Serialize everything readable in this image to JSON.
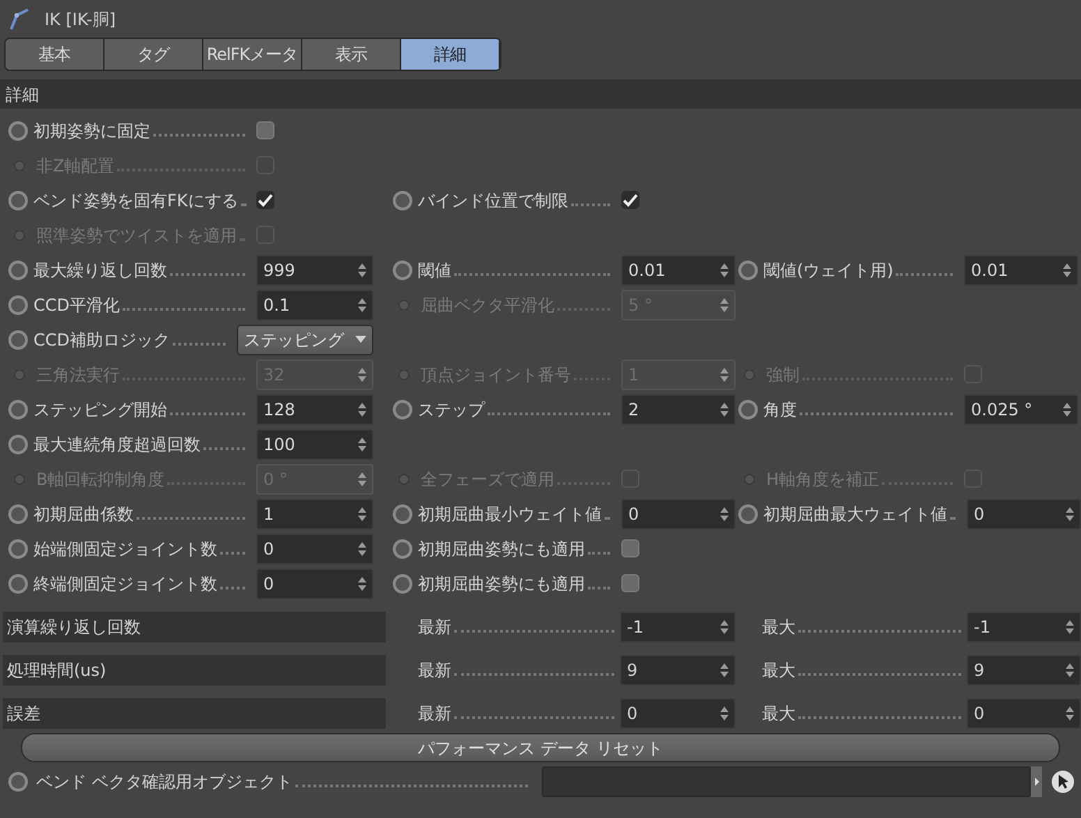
{
  "window": {
    "title": "IK [IK-胴]"
  },
  "tabs": [
    {
      "label": "基本",
      "selected": false
    },
    {
      "label": "タグ",
      "selected": false
    },
    {
      "label": "RelFKメータ",
      "selected": false
    },
    {
      "label": "表示",
      "selected": false
    },
    {
      "label": "詳細",
      "selected": true
    }
  ],
  "section": {
    "title": "詳細"
  },
  "rows": [
    {
      "col_1": {
        "kind": "checkbox",
        "label": "初期姿勢に固定",
        "checked": false,
        "disabled": false
      }
    },
    {
      "col_1": {
        "kind": "checkbox",
        "label": "非Z軸配置",
        "checked": false,
        "disabled": true
      }
    },
    {
      "col_1": {
        "kind": "checkbox",
        "label": "ベンド姿勢を固有FKにする",
        "checked": true,
        "disabled": false
      },
      "col_2": {
        "kind": "checkbox",
        "label": "バインド位置で制限",
        "checked": true,
        "disabled": false
      }
    },
    {
      "col_1": {
        "kind": "checkbox",
        "label": "照準姿勢でツイストを適用",
        "checked": false,
        "disabled": true
      }
    },
    {
      "col_1": {
        "kind": "number",
        "label": "最大繰り返し回数",
        "value": "999",
        "disabled": false
      },
      "col_2": {
        "kind": "number",
        "label": "閾値",
        "value": "0.01",
        "disabled": false
      },
      "col_3": {
        "kind": "number",
        "label": "閾値(ウェイト用)",
        "value": "0.01",
        "disabled": false
      }
    },
    {
      "col_1": {
        "kind": "number",
        "label": "CCD平滑化",
        "value": "0.1",
        "disabled": false
      },
      "col_2": {
        "kind": "number",
        "label": "屈曲ベクタ平滑化",
        "value": "5 °",
        "disabled": true
      }
    },
    {
      "col_1": {
        "kind": "dropdown",
        "label": "CCD補助ロジック",
        "value": "ステッピング",
        "disabled": false
      }
    },
    {
      "col_1": {
        "kind": "number",
        "label": "三角法実行",
        "value": "32",
        "disabled": true
      },
      "col_2": {
        "kind": "number",
        "label": "頂点ジョイント番号",
        "value": "1",
        "disabled": true
      },
      "col_3": {
        "kind": "checkbox",
        "label": "強制",
        "checked": false,
        "disabled": true
      }
    },
    {
      "col_1": {
        "kind": "number",
        "label": "ステッピング開始",
        "value": "128",
        "disabled": false
      },
      "col_2": {
        "kind": "number",
        "label": "ステップ",
        "value": "2",
        "disabled": false
      },
      "col_3": {
        "kind": "number",
        "label": "角度",
        "value": "0.025 °",
        "disabled": false
      }
    },
    {
      "col_1": {
        "kind": "number",
        "label": "最大連続角度超過回数",
        "value": "100",
        "disabled": false
      }
    },
    {
      "col_1": {
        "kind": "number",
        "label": "B軸回転抑制角度",
        "value": "0 °",
        "disabled": true
      },
      "col_2": {
        "kind": "checkbox",
        "label": "全フェーズで適用",
        "checked": false,
        "disabled": true
      },
      "col_3": {
        "kind": "checkbox",
        "label": "H軸角度を補正",
        "checked": false,
        "disabled": true
      }
    },
    {
      "col_1": {
        "kind": "number",
        "label": "初期屈曲係数",
        "value": "1",
        "disabled": false
      },
      "col_2": {
        "kind": "number",
        "label": "初期屈曲最小ウェイト値",
        "value": "0",
        "disabled": false
      },
      "col_3": {
        "kind": "number",
        "label": "初期屈曲最大ウェイト値",
        "value": "0",
        "disabled": false
      }
    },
    {
      "col_1": {
        "kind": "number",
        "label": "始端側固定ジョイント数",
        "value": "0",
        "disabled": false
      },
      "col_2": {
        "kind": "checkbox",
        "label": "初期屈曲姿勢にも適用",
        "checked": false,
        "disabled": false
      }
    },
    {
      "col_1": {
        "kind": "number",
        "label": "終端側固定ジョイント数",
        "value": "0",
        "disabled": false
      },
      "col_2": {
        "kind": "checkbox",
        "label": "初期屈曲姿勢にも適用",
        "checked": false,
        "disabled": false
      }
    }
  ],
  "stats": [
    {
      "label": "演算繰り返し回数",
      "latest_label": "最新",
      "latest": "-1",
      "max_label": "最大",
      "max": "-1"
    },
    {
      "label": "処理時間(us)",
      "latest_label": "最新",
      "latest": "9",
      "max_label": "最大",
      "max": "9"
    },
    {
      "label": "誤差",
      "latest_label": "最新",
      "latest": "0",
      "max_label": "最大",
      "max": "0"
    }
  ],
  "reset_button": {
    "label": "パフォーマンス データ リセット"
  },
  "link_field": {
    "label": "ベンド ベクタ確認用オブジェクト"
  }
}
